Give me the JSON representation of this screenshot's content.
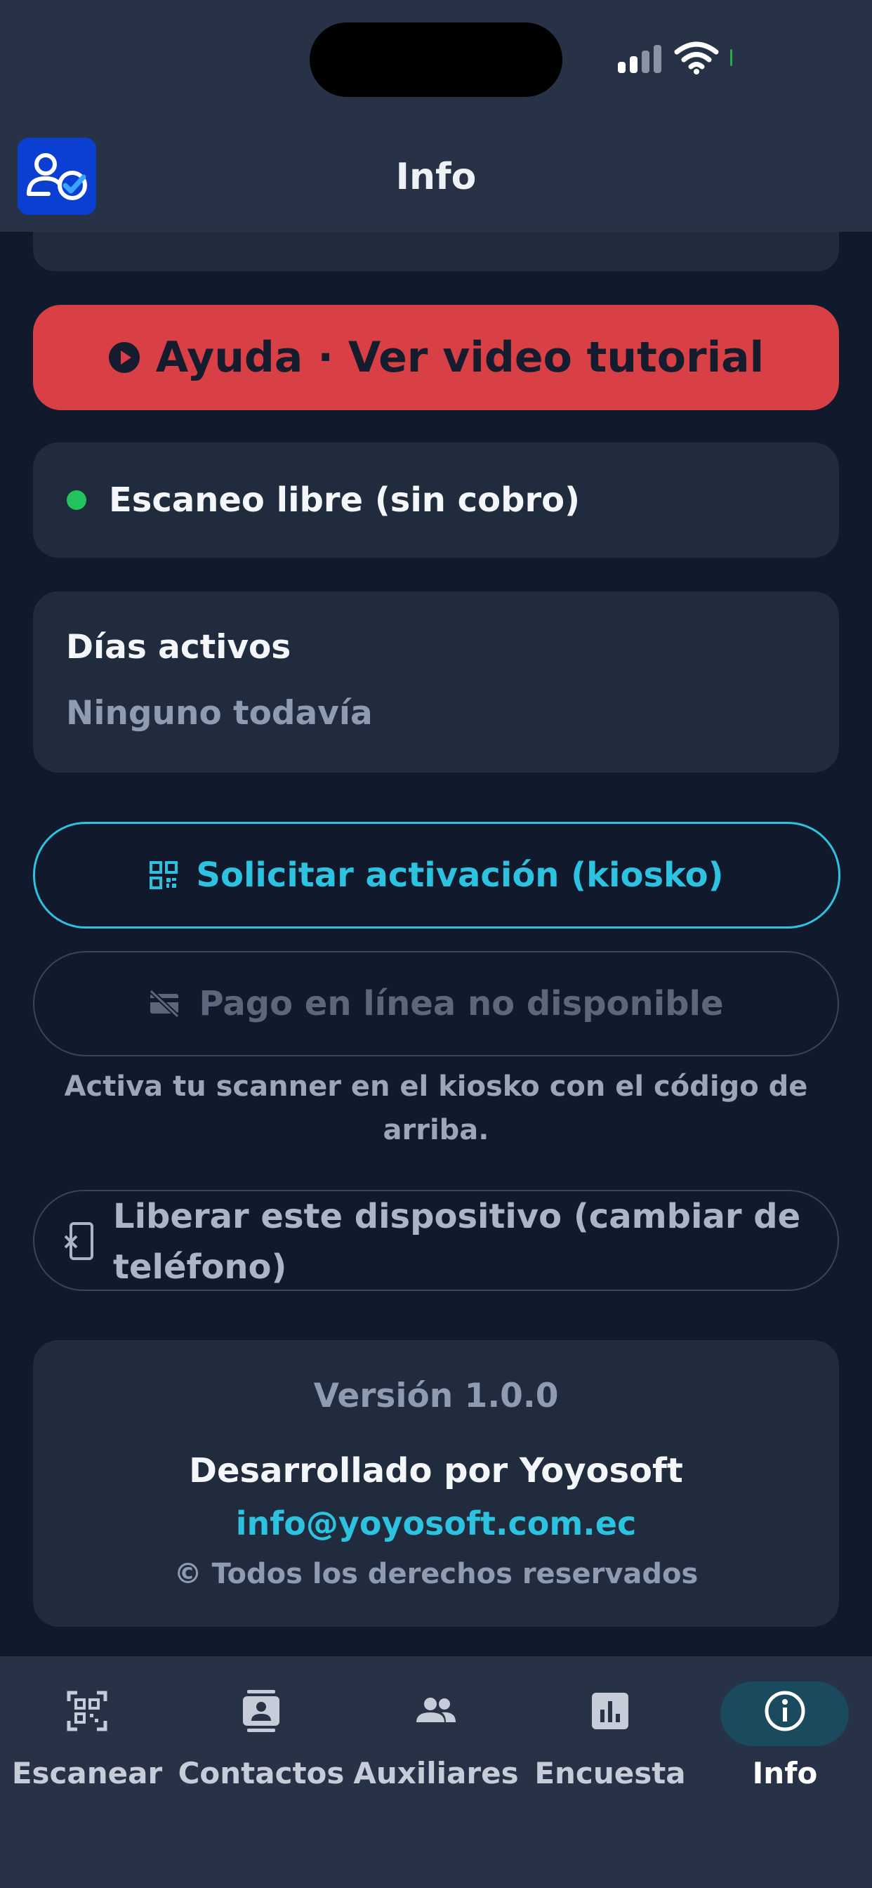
{
  "header": {
    "title": "Info"
  },
  "help": {
    "label": "Ayuda · Ver video tutorial"
  },
  "status": {
    "text": "Escaneo libre (sin cobro)",
    "dot_color": "#22c25e"
  },
  "days": {
    "title": "Días activos",
    "value": "Ninguno todavía"
  },
  "actions": {
    "activate_label": "Solicitar activación (kiosko)",
    "pay_label": "Pago en línea no disponible",
    "hint": "Activa tu scanner en el kiosko con el código de arriba.",
    "release_label": "Liberar este dispositivo (cambiar de teléfono)"
  },
  "footer": {
    "version": "Versión 1.0.0",
    "developer": "Desarrollado por Yoyosoft",
    "email": "info@yoyosoft.com.ec",
    "rights": "© Todos los derechos reservados"
  },
  "tabs": [
    {
      "label": "Escanear",
      "icon": "qr-scan-icon"
    },
    {
      "label": "Contactos",
      "icon": "contacts-icon"
    },
    {
      "label": "Auxiliares",
      "icon": "people-icon"
    },
    {
      "label": "Encuesta",
      "icon": "poll-icon"
    },
    {
      "label": "Info",
      "icon": "info-icon",
      "active": true
    }
  ],
  "colors": {
    "background": "#111a2c",
    "card": "#212b3e",
    "accent": "#2cc2e0",
    "danger": "#d84045",
    "logo": "#0b3fd1"
  }
}
